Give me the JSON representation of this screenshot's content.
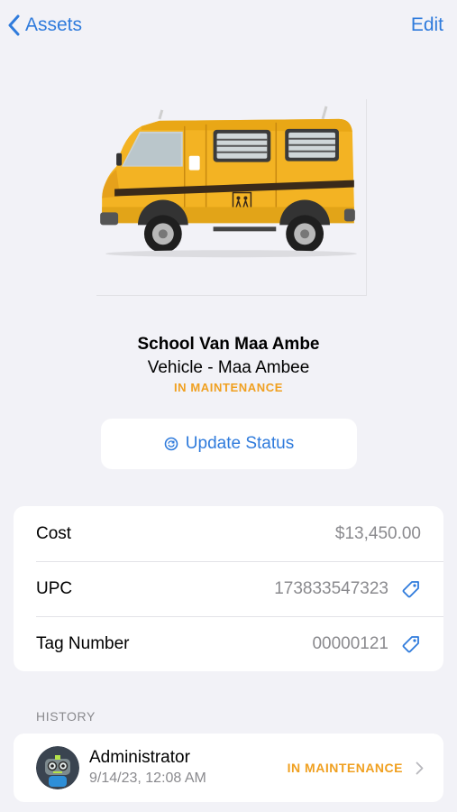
{
  "nav": {
    "back_label": "Assets",
    "edit_label": "Edit"
  },
  "asset": {
    "name": "School Van Maa Ambe",
    "subtitle": "Vehicle - Maa Ambee",
    "status": "IN MAINTENANCE",
    "image_icon": "school-van-photo"
  },
  "actions": {
    "update_status_label": "Update Status",
    "update_status_icon": "status-circle-icon"
  },
  "details": [
    {
      "label": "Cost",
      "value": "$13,450.00",
      "icon": null
    },
    {
      "label": "UPC",
      "value": "173833547323",
      "icon": "tag-icon"
    },
    {
      "label": "Tag Number",
      "value": "00000121",
      "icon": "tag-icon"
    }
  ],
  "history": {
    "header": "HISTORY",
    "entries": [
      {
        "user": "Administrator",
        "date": "9/14/23, 12:08 AM",
        "status": "IN MAINTENANCE"
      }
    ]
  },
  "colors": {
    "accent": "#2f7bdc",
    "status_orange": "#f0a020",
    "background": "#f2f2f7",
    "secondary_text": "#8a8a8e"
  }
}
